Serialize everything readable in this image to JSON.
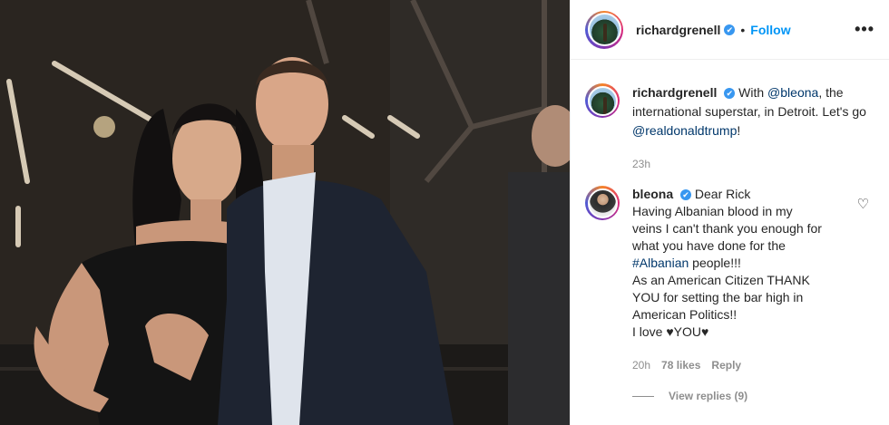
{
  "post": {
    "username": "richardgrenell",
    "verified_badge": "✔",
    "separator": "•",
    "follow_label": "Follow",
    "more_label": "•••"
  },
  "caption": {
    "username": "richardgrenell",
    "text_1": "With",
    "mention_1": "@bleona",
    "text_2": ", the international superstar, in Detroit. Let's go",
    "mention_2": "@realdonaldtrump",
    "text_3": "!",
    "timestamp": "23h"
  },
  "comment": {
    "username": "bleona",
    "lines": [
      "Dear Rick",
      "Having Albanian blood in my",
      "veins I can't thank you enough for",
      "what you have done for the",
      "people!!!",
      "As an American Citizen THANK",
      "YOU for setting the bar high in",
      "American Politics!!",
      "I love ♥YOU♥"
    ],
    "hashtag": "#Albanian",
    "time": "20h",
    "likes": "78 likes",
    "reply_label": "Reply",
    "view_replies": "View replies (9)"
  },
  "colors": {
    "accent_blue": "#0095f6",
    "mention_blue": "#00376b",
    "verified_blue": "#3897f0",
    "muted_text": "#8e8e8e"
  },
  "icons": {
    "more": "more-options-icon",
    "heart": "heart-icon",
    "verified": "verified-badge-icon"
  }
}
